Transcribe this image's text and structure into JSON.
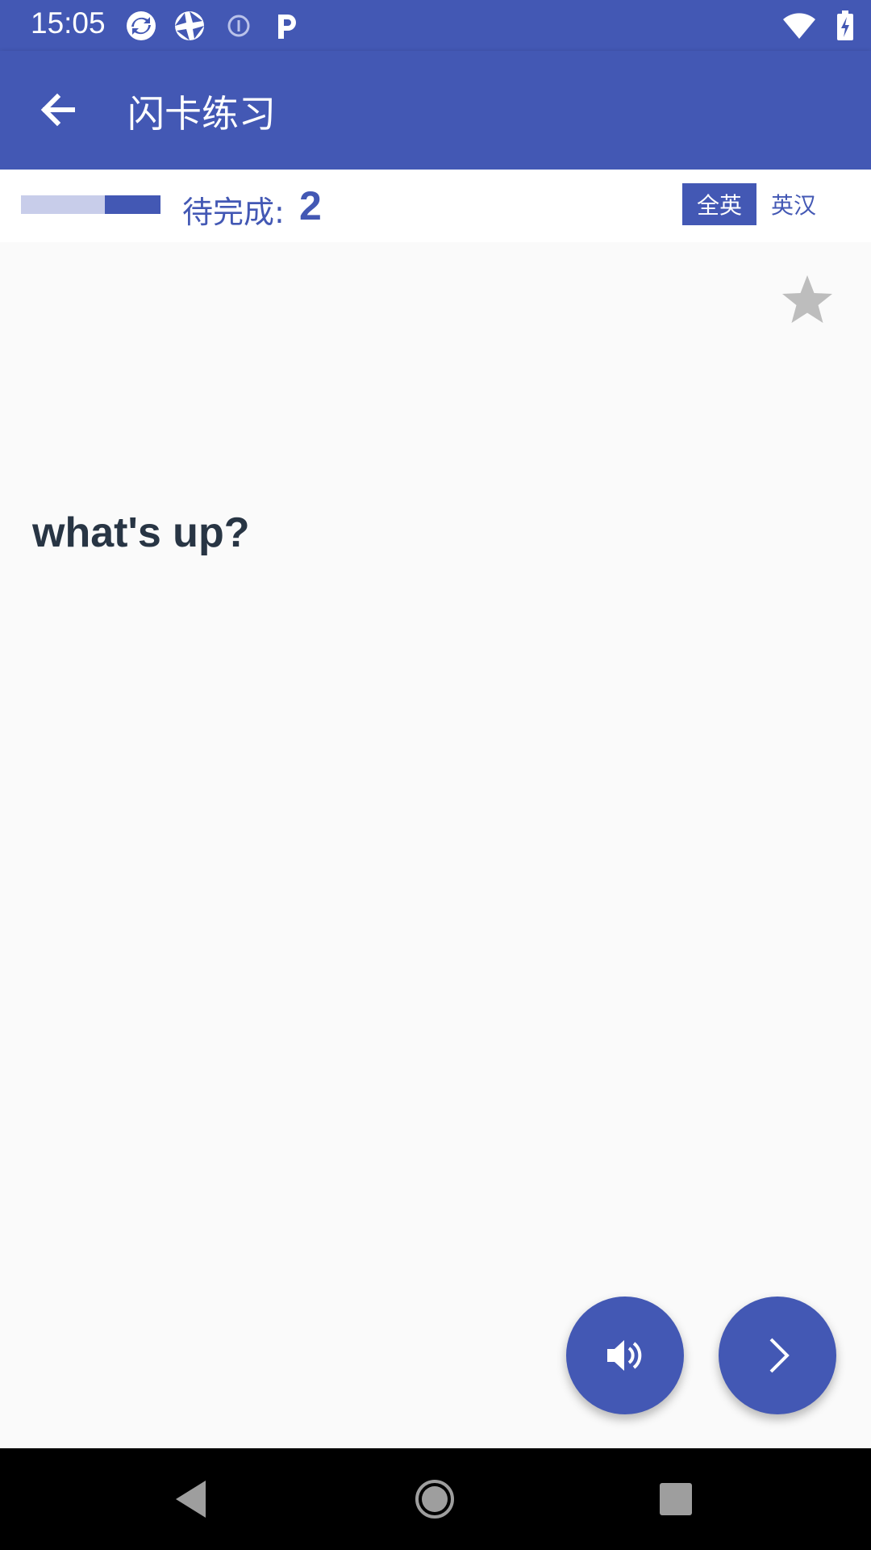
{
  "status_bar": {
    "time": "15:05",
    "left_icons": [
      "sync-icon",
      "aperture-icon",
      "info-circle-icon",
      "parking-p-icon"
    ],
    "right_icons": [
      "wifi-icon",
      "battery-icon"
    ]
  },
  "app_bar": {
    "title": "闪卡练习",
    "back_icon": "arrow-left-icon"
  },
  "info_row": {
    "pending_label": "待完成:",
    "pending_count": "2",
    "progress_fraction": 0.4,
    "mode_toggle": {
      "options": [
        "全英",
        "英汉"
      ],
      "selected": "全英"
    }
  },
  "card": {
    "text": "what's up?",
    "favorite_icon": "star-icon"
  },
  "actions": {
    "sound_icon": "speaker-icon",
    "next_icon": "chevron-right-icon"
  },
  "nav_bar": {
    "icons": [
      "nav-back-icon",
      "nav-home-icon",
      "nav-recents-icon"
    ]
  },
  "colors": {
    "primary": "#4358b4",
    "primary_light": "#c8cdea",
    "card_text": "#283544",
    "star_inactive": "#bdbdbd",
    "background": "#fafafa"
  }
}
